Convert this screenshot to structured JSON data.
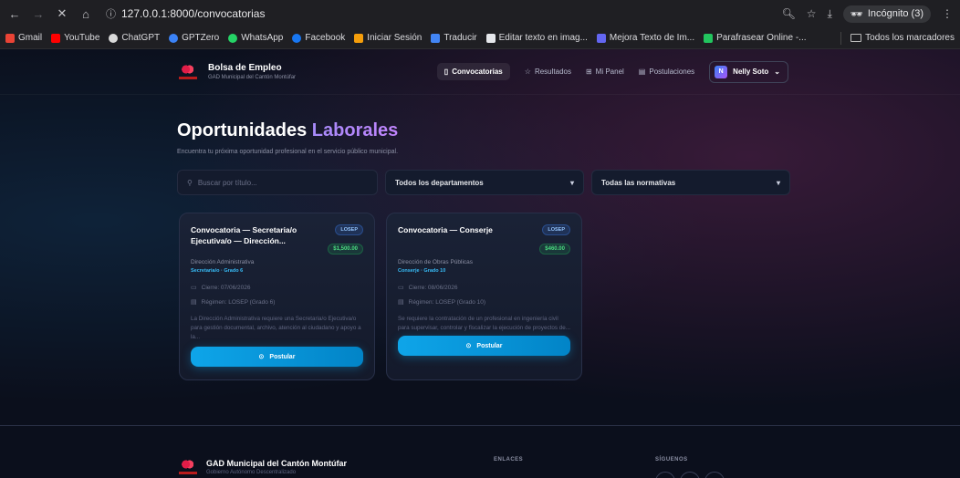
{
  "browser": {
    "url": "127.0.0.1:8000/convocatorias",
    "incognito_label": "Incógnito (3)",
    "bookmarks": [
      {
        "label": "Gmail",
        "color": "#ea4335"
      },
      {
        "label": "YouTube",
        "color": "#ff0000"
      },
      {
        "label": "ChatGPT",
        "color": "#d9d9d9"
      },
      {
        "label": "GPTZero",
        "color": "#3b82f6"
      },
      {
        "label": "WhatsApp",
        "color": "#25d366"
      },
      {
        "label": "Facebook",
        "color": "#1877f2"
      },
      {
        "label": "Iniciar Sesión",
        "color": "#f59e0b"
      },
      {
        "label": "Traducir",
        "color": "#4285f4"
      },
      {
        "label": "Editar texto en imag...",
        "color": "#e5e7eb"
      },
      {
        "label": "Mejora Texto de Im...",
        "color": "#6366f1"
      },
      {
        "label": "Parafrasear Online -...",
        "color": "#22c55e"
      }
    ],
    "all_bookmarks": "Todos los marcadores"
  },
  "app": {
    "brand_title": "Bolsa de Empleo",
    "brand_sub": "GAD Municipal del Cantón Montúfar",
    "nav": {
      "convocatorias": "Convocatorias",
      "resultados": "Resultados",
      "panel": "Mi Panel",
      "postulaciones": "Postulaciones"
    },
    "user_initial": "N",
    "user_name": "Nelly Soto"
  },
  "hero": {
    "title_main": "Oportunidades ",
    "title_accent": "Laborales",
    "subtitle": "Encuentra tu próxima oportunidad profesional en el servicio público municipal."
  },
  "filters": {
    "search_placeholder": "Buscar por título...",
    "department": "Todos los departamentos",
    "regulation": "Todas las normativas"
  },
  "cards": [
    {
      "title": "Convocatoria — Secretaria/o Ejecutiva/o — Dirección...",
      "law": "LOSEP",
      "salary": "$1,500.00",
      "department": "Dirección Administrativa",
      "grade": "Secretaria/o · Grado 6",
      "close": "Cierre: 07/06/2026",
      "regime": "Régimen: LOSEP (Grado 6)",
      "description": "La Dirección Administrativa requiere una Secretaria/o Ejecutiva/o para gestión documental, archivo, atención al ciudadano y apoyo a la...",
      "button": "Postular"
    },
    {
      "title": "Convocatoria — Conserje",
      "law": "LOSEP",
      "salary": "$460.00",
      "department": "Dirección de Obras Públicas",
      "grade": "Conserje · Grado 10",
      "close": "Cierre: 08/06/2026",
      "regime": "Régimen: LOSEP (Grado 10)",
      "description": "Se requiere la contratación de un profesional en ingeniería civil para supervisar, controlar y fiscalizar la ejecución de proyectos de...",
      "button": "Postular"
    }
  ],
  "footer": {
    "title": "GAD Municipal del Cantón Montúfar",
    "subtitle": "Gobierno Autónomo Descentralizado",
    "links_heading": "ENLACES",
    "social_heading": "SÍGUENOS"
  }
}
